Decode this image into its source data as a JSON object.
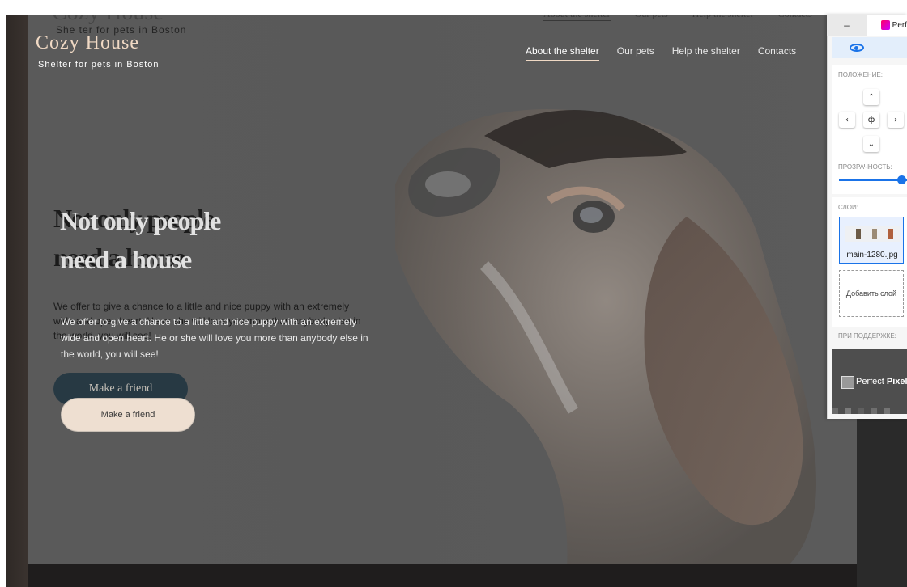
{
  "site": {
    "logo": "Cozy House",
    "logo_subtitle": "Shelter for pets in Boston",
    "nav": [
      "About the shelter",
      "Our pets",
      "Help the shelter",
      "Contacts"
    ],
    "hero_title_line1": "Not only people",
    "hero_title_line2": "need a house",
    "hero_description": "We offer to give a chance to a little and nice puppy with an extremely wide and open heart. He or she will love you more than anybody else in the world, you will see!",
    "cta_button": "Make a friend"
  },
  "overlay": {
    "logo": "Cozy House",
    "logo_subtitle": "She ter for pets in Boston",
    "nav": [
      "About the shelter",
      "Our pets",
      "Help the shelter",
      "Contacts"
    ],
    "hero_title_line1": "Not only people",
    "hero_title_line2": "need a house",
    "hero_description": "We offer to give a chance to a little and nice puppy with an extremely wide and open heart. He or she will love you more than anybody else in the world, you will see!",
    "cta_button": "Make a friend"
  },
  "perfect_pixel": {
    "tab_close": "–",
    "tab_title": "Perf",
    "position_label": "ПОЛОЖЕНИЕ:",
    "arrow_up": "⌃",
    "arrow_left": "‹",
    "arrow_center": "ф",
    "arrow_right": "›",
    "arrow_down": "⌄",
    "opacity_label": "ПРОЗРАЧНОСТЬ:",
    "opacity_value": 1.0,
    "layers_label": "СЛОИ:",
    "layer_name": "main-1280.jpg",
    "add_layer": "Добавить слой",
    "supported_label": "ПРИ ПОДДЕРЖКЕ:",
    "brand_regular": "Perfect ",
    "brand_bold": "Pixel"
  },
  "colors": {
    "accent": "#1a73e8",
    "logo_color": "#f0d9c4",
    "button_bg": "#eedfd1"
  }
}
